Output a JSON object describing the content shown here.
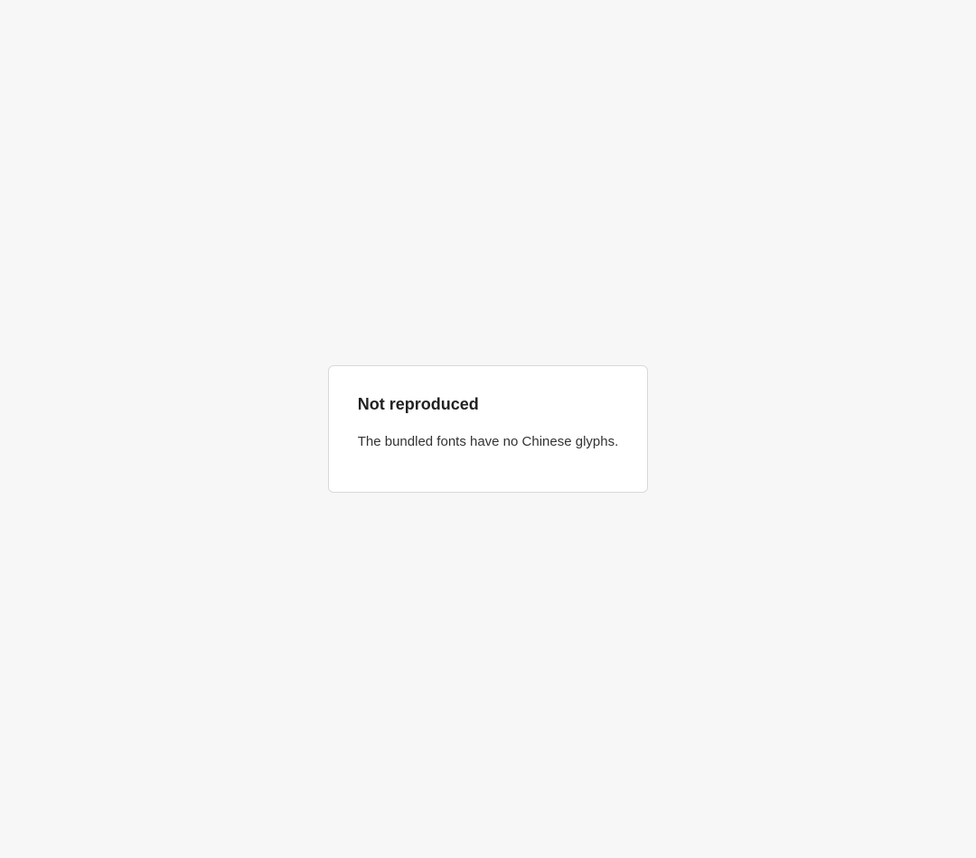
{
  "notice": {
    "title": "Not reproduced",
    "body": "The bundled fonts have no Chinese glyphs."
  }
}
